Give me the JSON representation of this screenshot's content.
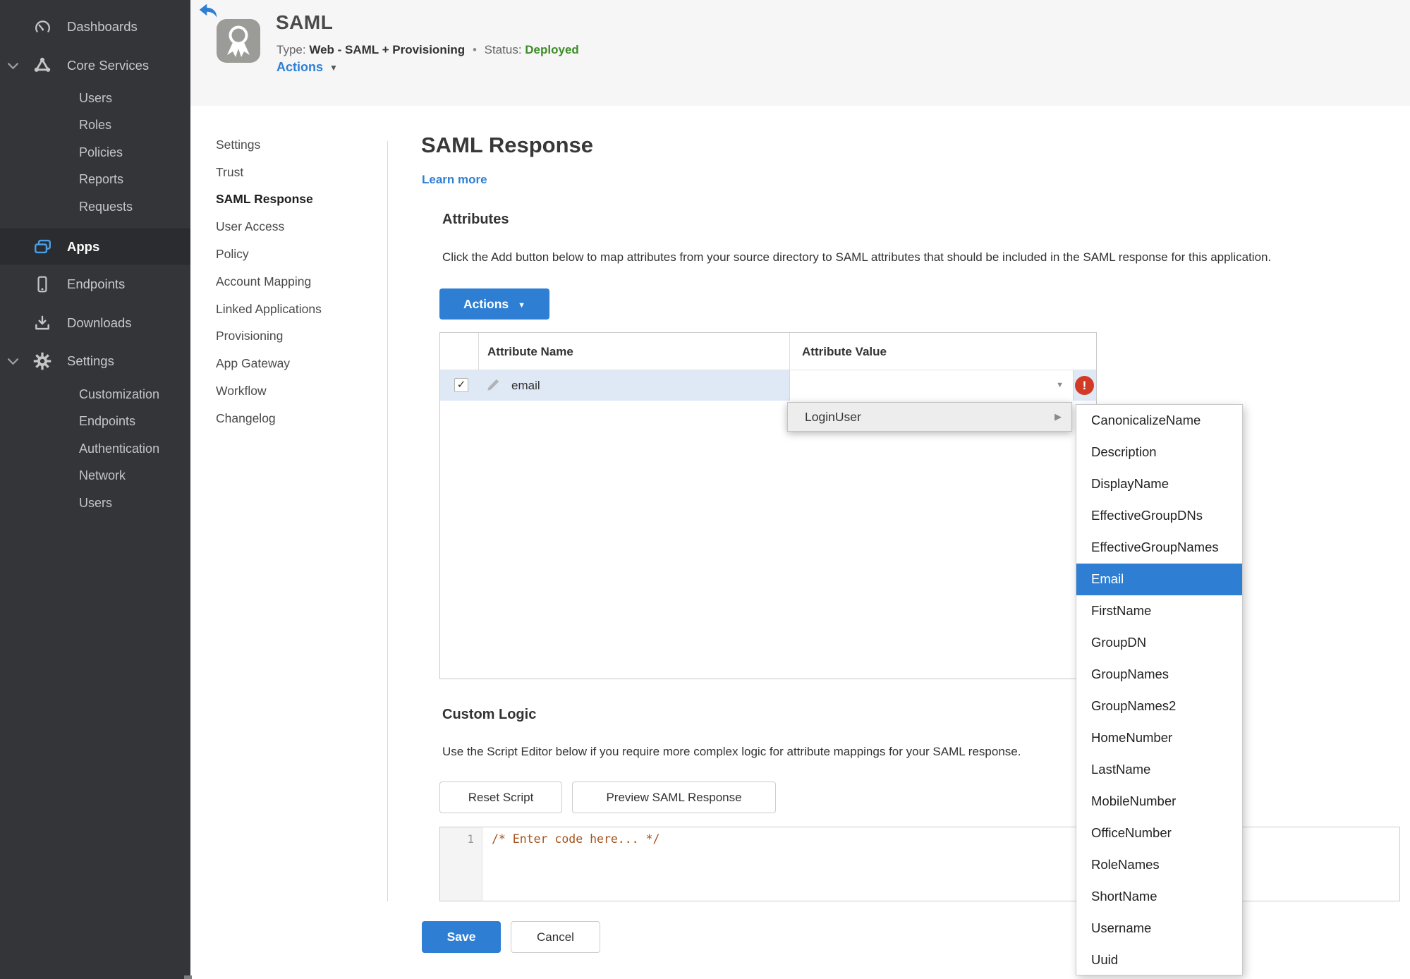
{
  "colors": {
    "accent_blue": "#2e7fd4",
    "status_green": "#3e8c28",
    "error_red": "#d13b26",
    "sidebar_bg": "#333539",
    "row_highlight": "#dfe9f6",
    "code_comment": "#a6521b"
  },
  "icons": {
    "caret_down": "▼",
    "submenu_arrow": "▶",
    "check": "✓",
    "error_mark": "!"
  },
  "sidebar": {
    "dashboards": "Dashboards",
    "core_services": "Core Services",
    "core_children": [
      "Users",
      "Roles",
      "Policies",
      "Reports",
      "Requests"
    ],
    "apps": "Apps",
    "endpoints": "Endpoints",
    "downloads": "Downloads",
    "settings": "Settings",
    "settings_children": [
      "Customization",
      "Endpoints",
      "Authentication",
      "Network",
      "Users"
    ]
  },
  "header": {
    "title": "SAML",
    "type_label": "Type:",
    "type_value": "Web - SAML + Provisioning",
    "separator": "•",
    "status_label": "Status:",
    "status_value": "Deployed",
    "actions_label": "Actions"
  },
  "nav": {
    "items": [
      {
        "label": "Settings",
        "active": false
      },
      {
        "label": "Trust",
        "active": false
      },
      {
        "label": "SAML Response",
        "active": true
      },
      {
        "label": "User Access",
        "active": false
      },
      {
        "label": "Policy",
        "active": false
      },
      {
        "label": "Account Mapping",
        "active": false
      },
      {
        "label": "Linked Applications",
        "active": false
      },
      {
        "label": "Provisioning",
        "active": false
      },
      {
        "label": "App Gateway",
        "active": false
      },
      {
        "label": "Workflow",
        "active": false
      },
      {
        "label": "Changelog",
        "active": false
      }
    ]
  },
  "main": {
    "title": "SAML Response",
    "learn_more": "Learn more",
    "attributes": {
      "heading": "Attributes",
      "description": "Click the Add button below to map attributes from your source directory to SAML attributes that should be included in the SAML response for this application.",
      "actions_button": "Actions",
      "table": {
        "columns": [
          "Attribute Name",
          "Attribute Value"
        ],
        "rows": [
          {
            "name": "email",
            "value": "",
            "checked": true,
            "error": true
          }
        ]
      }
    },
    "custom_logic": {
      "heading": "Custom Logic",
      "description": "Use the Script Editor below if you require more complex logic for attribute mappings for your SAML response.",
      "reset_button": "Reset Script",
      "preview_button": "Preview SAML Response",
      "editor": {
        "line_number": "1",
        "code": "/* Enter code here... */"
      }
    },
    "save_button": "Save",
    "cancel_button": "Cancel"
  },
  "dropdown": {
    "parent_item": "LoginUser",
    "selected_option": "Email",
    "options": [
      "CanonicalizeName",
      "Description",
      "DisplayName",
      "EffectiveGroupDNs",
      "EffectiveGroupNames",
      "Email",
      "FirstName",
      "GroupDN",
      "GroupNames",
      "GroupNames2",
      "HomeNumber",
      "LastName",
      "MobileNumber",
      "OfficeNumber",
      "RoleNames",
      "ShortName",
      "Username",
      "Uuid"
    ]
  }
}
